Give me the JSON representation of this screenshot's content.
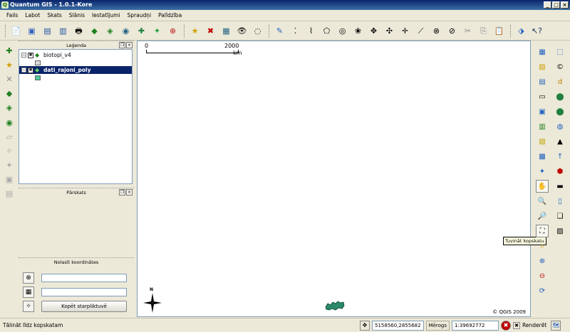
{
  "window": {
    "title": "Quantum GIS - 1.0.1-Kore",
    "buttons": [
      "_",
      "□",
      "×"
    ]
  },
  "menu": {
    "items": [
      "Fails",
      "Labot",
      "Skats",
      "Slānis",
      "Iestatījumi",
      "Spraudņi",
      "Palīdzība"
    ]
  },
  "panels": {
    "legend": {
      "title": "Leģenda",
      "layers": [
        {
          "name": "biotopi_v4",
          "checked": true,
          "expanded": false,
          "symbol_color": "#dcdcdc"
        },
        {
          "name": "dati_rajoni_poly",
          "checked": true,
          "expanded": true,
          "selected": true,
          "symbol_color": "#4cc99b"
        }
      ]
    },
    "overview": {
      "title": "Pārskats"
    },
    "coordinates": {
      "title": "Nolasīt koordinātes",
      "copy_button": "Kopēt starpliktuvē"
    }
  },
  "map": {
    "scale_start": "0",
    "scale_end": "2000",
    "scale_unit": "km",
    "north_label": "N",
    "copyright": "© QGIS 2009",
    "island_color": "#2a8a6a"
  },
  "tooltip": "Tuvināt kopskatu",
  "statusbar": {
    "message": "Tālināt līdz kopskatam",
    "coords": "5158560,2855682",
    "scale_label": "Mērogs",
    "scale_value": "1:39692772",
    "render_label": "Renderēt",
    "render_checked": true
  }
}
